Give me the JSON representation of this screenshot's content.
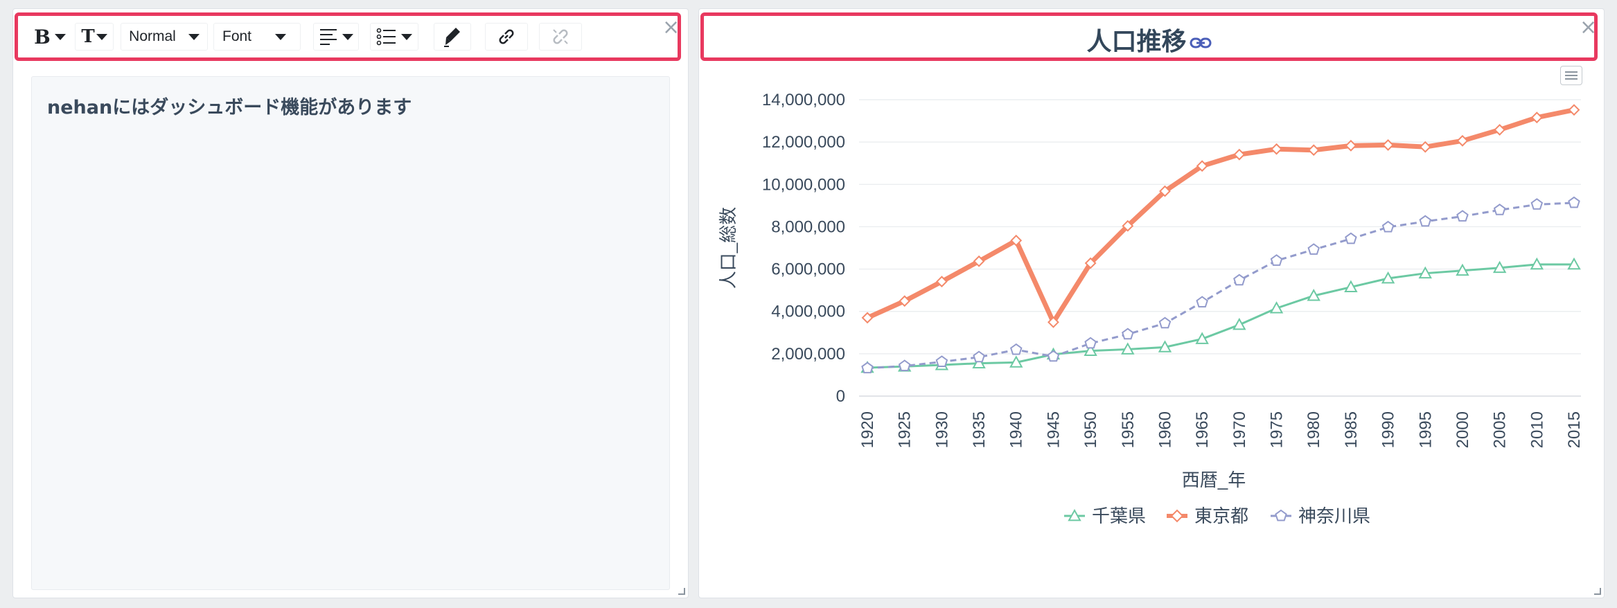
{
  "toolbar": {
    "bold_label": "B",
    "textsize_label": "T",
    "paragraph_style": "Normal",
    "font": "Font",
    "icons": [
      "bold-icon",
      "text-size-icon",
      "align-icon",
      "list-icon",
      "pen-icon",
      "link-icon",
      "unlink-icon"
    ]
  },
  "editor": {
    "content": "nehanにはダッシュボード機能があります"
  },
  "chart_panel": {
    "close_label": "×"
  },
  "text_panel": {
    "close_label": "×"
  },
  "colors": {
    "highlight_border": "#e8395f",
    "tokyo": "#f4896a",
    "chiba": "#6cc9a3",
    "kanagawa": "#939bcc"
  },
  "chart_data": {
    "type": "line",
    "title": "人口推移",
    "xlabel": "西暦_年",
    "ylabel": "人口_総数",
    "x": [
      1920,
      1925,
      1930,
      1935,
      1940,
      1945,
      1950,
      1955,
      1960,
      1965,
      1970,
      1975,
      1980,
      1985,
      1990,
      1995,
      2000,
      2005,
      2010,
      2015
    ],
    "ylim": [
      0,
      14000000
    ],
    "yticks": [
      0,
      2000000,
      4000000,
      6000000,
      8000000,
      10000000,
      12000000,
      14000000
    ],
    "ytick_labels": [
      "0",
      "2,000,000",
      "4,000,000",
      "6,000,000",
      "8,000,000",
      "10,000,000",
      "12,000,000",
      "14,000,000"
    ],
    "grid": true,
    "legend": "bottom-center",
    "series": [
      {
        "name": "千葉県",
        "color": "#6cc9a3",
        "style": "solid",
        "marker": "triangle",
        "values": [
          1340000,
          1400000,
          1470000,
          1550000,
          1590000,
          1970000,
          2140000,
          2210000,
          2310000,
          2700000,
          3370000,
          4150000,
          4740000,
          5150000,
          5560000,
          5800000,
          5930000,
          6060000,
          6220000,
          6220000
        ]
      },
      {
        "name": "東京都",
        "color": "#f4896a",
        "style": "solid",
        "marker": "diamond",
        "values": [
          3700000,
          4490000,
          5410000,
          6370000,
          7350000,
          3490000,
          6280000,
          8040000,
          9680000,
          10870000,
          11410000,
          11670000,
          11620000,
          11830000,
          11860000,
          11770000,
          12060000,
          12580000,
          13160000,
          13520000
        ]
      },
      {
        "name": "神奈川県",
        "color": "#939bcc",
        "style": "dashed",
        "marker": "pentagon",
        "values": [
          1320000,
          1420000,
          1620000,
          1840000,
          2190000,
          1870000,
          2490000,
          2920000,
          3440000,
          4430000,
          5470000,
          6400000,
          6920000,
          7430000,
          7980000,
          8250000,
          8490000,
          8790000,
          9050000,
          9130000
        ]
      }
    ]
  }
}
